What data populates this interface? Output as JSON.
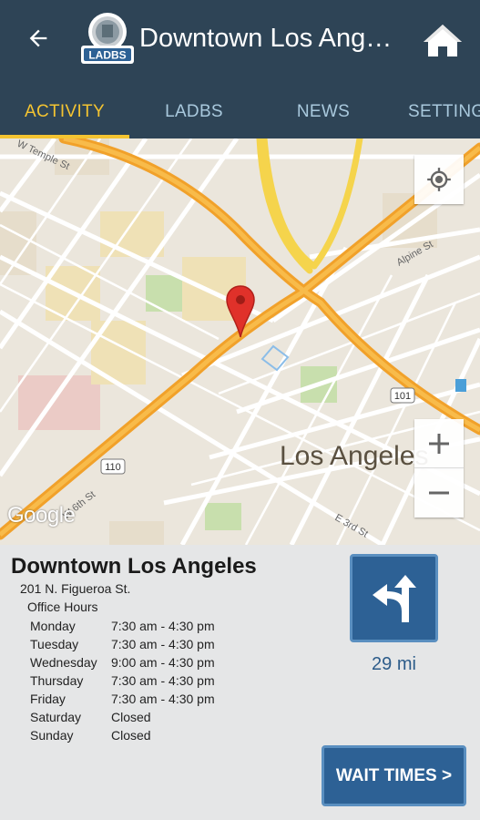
{
  "app_bar": {
    "title": "Downtown Los Angeles",
    "logo_text": "LADBS",
    "colors": {
      "background": "#2e4456",
      "accent": "#f4c431",
      "tab_text": "#a9c9dd"
    }
  },
  "tabs": [
    {
      "label": "ACTIVITY",
      "active": true
    },
    {
      "label": "LADBS",
      "active": false
    },
    {
      "label": "NEWS",
      "active": false
    },
    {
      "label": "SETTINGS",
      "active": false
    }
  ],
  "map": {
    "city_label": "Los Angeles",
    "provider_logo": "Google",
    "street_labels": [
      "W Temple St",
      "Alpine St",
      "W 6th St",
      "E 3rd St"
    ],
    "highway_shields": [
      "110",
      "101"
    ]
  },
  "office": {
    "name": "Downtown Los Angeles",
    "address": "201 N. Figueroa St.",
    "hours_label": "Office Hours",
    "hours": [
      {
        "day": "Monday",
        "time": "7:30 am - 4:30 pm"
      },
      {
        "day": "Tuesday",
        "time": "7:30 am - 4:30 pm"
      },
      {
        "day": "Wednesday",
        "time": "9:00 am - 4:30 pm"
      },
      {
        "day": "Thursday",
        "time": "7:30 am - 4:30 pm"
      },
      {
        "day": "Friday",
        "time": "7:30 am - 4:30 pm"
      },
      {
        "day": "Saturday",
        "time": "Closed"
      },
      {
        "day": "Sunday",
        "time": "Closed"
      }
    ],
    "distance": "29 mi",
    "wait_times_label": "WAIT TIMES >"
  },
  "icons": {
    "back": "arrow-left-icon",
    "home": "home-icon",
    "locate": "my-location-icon",
    "zoom_in": "plus-icon",
    "zoom_out": "minus-icon",
    "directions": "directions-fork-icon",
    "pin": "map-pin-icon"
  }
}
